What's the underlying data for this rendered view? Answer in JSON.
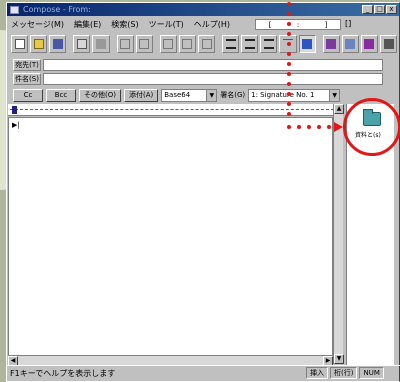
{
  "window": {
    "title": "Compose - From: ",
    "controls": [
      "_",
      "□",
      "x"
    ]
  },
  "menu": {
    "items": [
      "メッセージ(M)",
      "編集(E)",
      "検索(S)",
      "ツール(T)",
      "ヘルプ(H)"
    ],
    "status_box": [
      "[",
      ":",
      "]",
      "[]"
    ]
  },
  "fields": {
    "to_label": "宛先(T)",
    "subject_label": "件名(S)"
  },
  "format_bar": {
    "cc_label": "Cc",
    "bcc_label": "Bcc",
    "other_button": "その他(O)",
    "attach_button": "添付(A)",
    "encoding": "Base64",
    "signature_label": "署名(G)",
    "signature_value": "1: Signature No. 1"
  },
  "sidepanel": {
    "folder_label": "資料と(s)"
  },
  "statusbar": {
    "help_text": "F1キーでヘルプを表示します",
    "insert": "挿入",
    "column": "桁(行)",
    "num": "NUM"
  },
  "accent": "#e01818"
}
